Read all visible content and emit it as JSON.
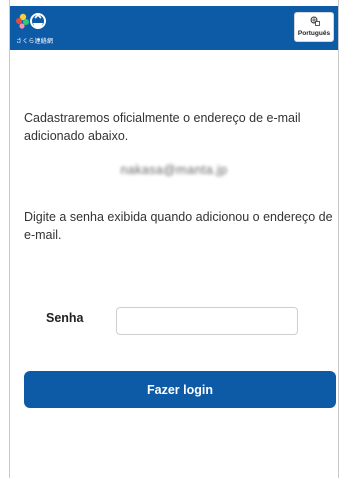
{
  "header": {
    "logo_text": "さくら連絡網",
    "language_label": "Português",
    "colors": {
      "brand": "#0d5aa7",
      "header_bg": "#0d5aa7",
      "button_bg": "#0d5aa7"
    }
  },
  "main": {
    "message_registration": "Cadastraremos oficialmente o endereço de e-mail adicionado abaixo.",
    "email_address": "nakasa@manta.jp",
    "message_instruction": "Digite a senha exibida quando adicionou o endereço de e-mail.",
    "password_label": "Senha",
    "password_value": "",
    "password_placeholder": "",
    "login_button_label": "Fazer login"
  },
  "icons": {
    "logo": "sakura-renrakumo-logo",
    "language": "language-globe-icon"
  }
}
